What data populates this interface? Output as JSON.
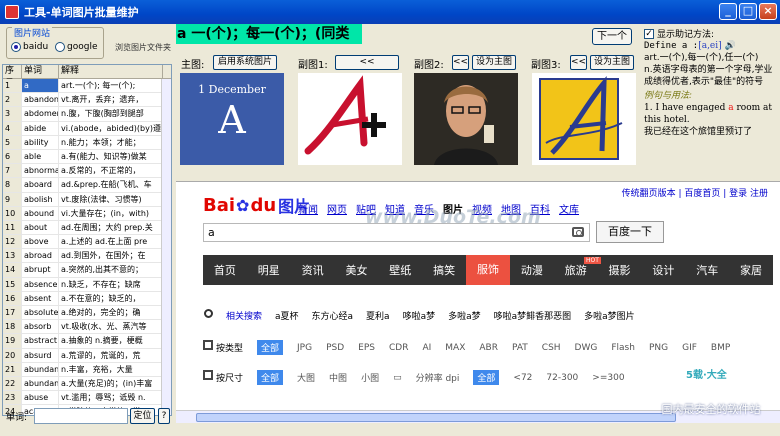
{
  "window": {
    "title": "工具-单词图片批量维护"
  },
  "site": {
    "group_title": "图片网站",
    "options": [
      "baidu",
      "google"
    ],
    "selected": "baidu",
    "browse_label": "浏览图片文件夹"
  },
  "table": {
    "headers": [
      "序号",
      "单词",
      "解释"
    ],
    "rows": [
      [
        "1",
        "a",
        "art.一(个); 每一(个);"
      ],
      [
        "2",
        "abandon",
        "vt.离开，丢弃；遗弃，"
      ],
      [
        "3",
        "abdomen",
        "n.腹，下腹(胸部到腿部"
      ],
      [
        "4",
        "abide",
        "vi.(abode，abided)(by)遵"
      ],
      [
        "5",
        "ability",
        "n.能力；本领；才能；"
      ],
      [
        "6",
        "able",
        "a.有(能力、知识等)做某"
      ],
      [
        "7",
        "abnormal",
        "a.反常的，不正常的，"
      ],
      [
        "8",
        "aboard",
        "ad.&prep.在船(飞机、车"
      ],
      [
        "9",
        "abolish",
        "vt.废除(法律、习惯等)"
      ],
      [
        "10",
        "abound",
        "vi.大量存在；(in，with)"
      ],
      [
        "11",
        "about",
        "ad.在周围；大约 prep.关"
      ],
      [
        "12",
        "above",
        "a.上述的 ad.在上面 pre"
      ],
      [
        "13",
        "abroad",
        "ad.到国外，在国外；在"
      ],
      [
        "14",
        "abrupt",
        "a.突然的,出其不意的；"
      ],
      [
        "15",
        "absence",
        "n.缺乏，不存在；缺席"
      ],
      [
        "16",
        "absent",
        "a.不在意的；缺乏的，"
      ],
      [
        "17",
        "absolute",
        "a.绝对的，完全的；确"
      ],
      [
        "18",
        "absorb",
        "vt.吸收(水、光、蒸汽等"
      ],
      [
        "19",
        "abstract",
        "a.抽象的 n.摘要，梗概"
      ],
      [
        "20",
        "absurd",
        "a.荒谬的，荒诞的，荒"
      ],
      [
        "21",
        "abundance",
        "n.丰富，充裕，大量"
      ],
      [
        "22",
        "abundant",
        "a.大量(充足)的；(in)丰富"
      ],
      [
        "23",
        "abuse",
        "vt.滥用；辱骂；诋毁 n."
      ],
      [
        "24",
        "academic",
        "a.学院的，大学的；学"
      ]
    ],
    "selected_row": 0
  },
  "lookup": {
    "word_label": "单词:",
    "word_value": "",
    "locate_button": "定位",
    "help_button": "?"
  },
  "headword": {
    "text": "a 一(个)；每一(个)；(同类"
  },
  "images": {
    "main_label": "主图:",
    "use_system_button": "启用系统图片",
    "sub1_label": "副图1:",
    "sub2_label": "副图2:",
    "sub3_label": "副图3:",
    "left_arrow": "<<",
    "set_main_button": "设为主图",
    "next_button": "下一个",
    "main_thumb_small": "1 December",
    "main_thumb_big": "A"
  },
  "definition": {
    "show_mnemonic_label": "显示助记方法:",
    "show_mnemonic_checked": true,
    "define_prefix": "Define a :",
    "phonetic": "[a,ei]",
    "sense1": "art.一(个),每一(个),任一(个)",
    "sense2": "n.英语字母表的第一个字母,学业成绩得优者,表示\"最佳\"的符号",
    "examples_heading": "例句与用法:",
    "example_en_pre": "1. I have engaged ",
    "example_en_red": "a",
    "example_en_post": " room at this hotel.",
    "example_zh": "我已经在这个旅馆里预订了"
  },
  "browser": {
    "toplinks": "传统翻页版本 | 百度首页 | 登录 注册",
    "logo": {
      "bai": "Bai",
      "du": "du",
      "tu": "图片"
    },
    "channels": [
      "新闻",
      "网页",
      "贴吧",
      "知道",
      "音乐",
      "图片",
      "视频",
      "地图",
      "百科",
      "文库"
    ],
    "current_channel": "图片",
    "query": "a",
    "search_button": "百度一下",
    "watermark": "www.DuoTe.com",
    "nav": [
      "首页",
      "明星",
      "资讯",
      "美女",
      "壁纸",
      "搞笑",
      "服饰",
      "动漫",
      "旅游",
      "摄影",
      "设计",
      "汽车",
      "家居"
    ],
    "nav_active": "服饰",
    "hot_tag": "HOT",
    "related_label": "相关搜索",
    "related": [
      "a夏杯",
      "东方心经a",
      "夏利a",
      "哆啦a梦",
      "多啦a梦",
      "哆啦a梦鲱香那恶图",
      "多啦a梦图片"
    ],
    "type_filter": {
      "name": "按类型",
      "options": [
        "全部",
        "JPG",
        "PSD",
        "EPS",
        "CDR",
        "AI",
        "MAX",
        "ABR",
        "PAT",
        "CSH",
        "DWG",
        "Flash",
        "PNG",
        "GIF",
        "BMP"
      ],
      "selected": "全部"
    },
    "size_filter": {
      "name": "按尺寸",
      "options": [
        "全部",
        "大图",
        "中图",
        "小图"
      ],
      "selected": "全部",
      "resolution_label": "分辨率 dpi",
      "resolution_options": [
        "全部",
        "<72",
        "72-300",
        ">=300"
      ],
      "resolution_selected": "全部"
    }
  },
  "corner_logo": {
    "brand": "5载·大全",
    "url": "www.DuoTe.com",
    "tagline": "国内最安全的软件站"
  }
}
